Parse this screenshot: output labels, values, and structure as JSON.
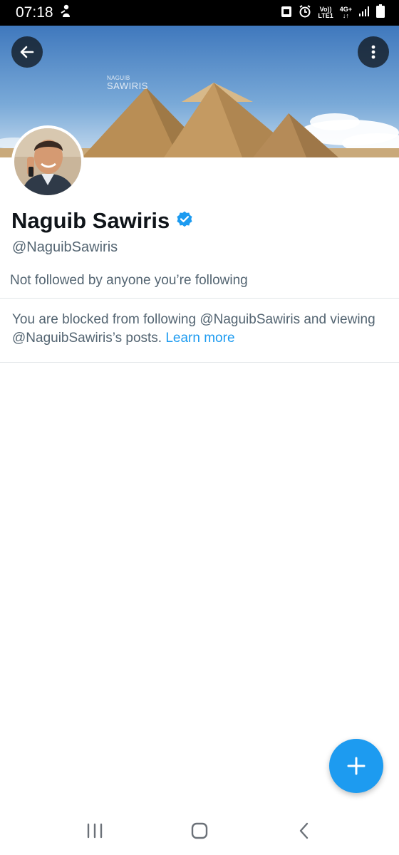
{
  "status_bar": {
    "time": "07:18",
    "network_top": "Vo))",
    "network_bottom": "LTE1",
    "signal_type": "4G+",
    "icons": [
      "notification-icon",
      "alarm-icon",
      "signal-icon",
      "battery-icon"
    ]
  },
  "banner": {
    "logo_line1": "NAGUIB",
    "logo_line2": "SAWIRIS"
  },
  "profile": {
    "display_name": "Naguib Sawiris",
    "handle": "@NaguibSawiris",
    "followers_note": "Not followed by anyone you’re following",
    "blocked_text": "You are blocked from following @NaguibSawiris and viewing @NaguibSawiris’s posts.",
    "learn_more": "Learn more"
  },
  "colors": {
    "accent": "#1d9bf0",
    "secondary_text": "#536471",
    "primary_text": "#0f1419"
  }
}
